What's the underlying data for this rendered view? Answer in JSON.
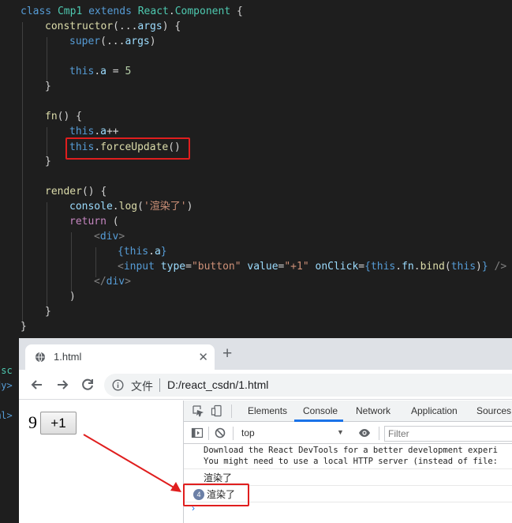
{
  "code": {
    "line1": [
      {
        "t": "class ",
        "c": "k"
      },
      {
        "t": "Cmp1 ",
        "c": "cls"
      },
      {
        "t": "extends ",
        "c": "k"
      },
      {
        "t": "React",
        "c": "cls"
      },
      {
        "t": ".",
        "c": ""
      },
      {
        "t": "Component",
        "c": "cls"
      },
      {
        "t": " {",
        "c": ""
      }
    ],
    "line2": [
      {
        "t": "constructor",
        "c": "fn"
      },
      {
        "t": "(...",
        "c": ""
      },
      {
        "t": "args",
        "c": "pr"
      },
      {
        "t": ") {",
        "c": ""
      }
    ],
    "line3": [
      {
        "t": "super",
        "c": "k"
      },
      {
        "t": "(...",
        "c": ""
      },
      {
        "t": "args",
        "c": "pr"
      },
      {
        "t": ")",
        "c": ""
      }
    ],
    "line5": [
      {
        "t": "this",
        "c": "k"
      },
      {
        "t": ".",
        "c": ""
      },
      {
        "t": "a",
        "c": "pr"
      },
      {
        "t": " = ",
        "c": ""
      },
      {
        "t": "5",
        "c": "num"
      }
    ],
    "line6": [
      {
        "t": "}",
        "c": ""
      }
    ],
    "line8": [
      {
        "t": "fn",
        "c": "fn"
      },
      {
        "t": "() {",
        "c": ""
      }
    ],
    "line9": [
      {
        "t": "this",
        "c": "k"
      },
      {
        "t": ".",
        "c": ""
      },
      {
        "t": "a",
        "c": "pr"
      },
      {
        "t": "++",
        "c": ""
      }
    ],
    "line10": [
      {
        "t": "this",
        "c": "k"
      },
      {
        "t": ".",
        "c": ""
      },
      {
        "t": "forceUpdate",
        "c": "fn"
      },
      {
        "t": "()",
        "c": ""
      }
    ],
    "line11": [
      {
        "t": "}",
        "c": ""
      }
    ],
    "line13": [
      {
        "t": "render",
        "c": "fn"
      },
      {
        "t": "() {",
        "c": ""
      }
    ],
    "line14": [
      {
        "t": "console",
        "c": "pr"
      },
      {
        "t": ".",
        "c": ""
      },
      {
        "t": "log",
        "c": "fn"
      },
      {
        "t": "(",
        "c": ""
      },
      {
        "t": "'渲染了'",
        "c": "str"
      },
      {
        "t": ")",
        "c": ""
      }
    ],
    "line15": [
      {
        "t": "return",
        "c": "kc"
      },
      {
        "t": " (",
        "c": ""
      }
    ],
    "line16": [
      {
        "t": "<",
        "c": "p"
      },
      {
        "t": "div",
        "c": "tag"
      },
      {
        "t": ">",
        "c": "p"
      }
    ],
    "line17": [
      {
        "t": "{",
        "c": "k"
      },
      {
        "t": "this",
        "c": "k"
      },
      {
        "t": ".",
        "c": ""
      },
      {
        "t": "a",
        "c": "pr"
      },
      {
        "t": "}",
        "c": "k"
      }
    ],
    "line18": [
      {
        "t": "<",
        "c": "p"
      },
      {
        "t": "input ",
        "c": "tag"
      },
      {
        "t": "type",
        "c": "pr"
      },
      {
        "t": "=",
        "c": ""
      },
      {
        "t": "\"button\"",
        "c": "str"
      },
      {
        "t": " ",
        "c": ""
      },
      {
        "t": "value",
        "c": "pr"
      },
      {
        "t": "=",
        "c": ""
      },
      {
        "t": "\"+1\"",
        "c": "str"
      },
      {
        "t": " ",
        "c": ""
      },
      {
        "t": "onClick",
        "c": "pr"
      },
      {
        "t": "=",
        "c": ""
      },
      {
        "t": "{",
        "c": "k"
      },
      {
        "t": "this",
        "c": "k"
      },
      {
        "t": ".",
        "c": ""
      },
      {
        "t": "fn",
        "c": "pr"
      },
      {
        "t": ".",
        "c": ""
      },
      {
        "t": "bind",
        "c": "fn"
      },
      {
        "t": "(",
        "c": ""
      },
      {
        "t": "this",
        "c": "k"
      },
      {
        "t": ")",
        "c": ""
      },
      {
        "t": "}",
        "c": "k"
      },
      {
        "t": " />",
        "c": "p"
      }
    ],
    "line19": [
      {
        "t": "</",
        "c": "p"
      },
      {
        "t": "div",
        "c": "tag"
      },
      {
        "t": ">",
        "c": "p"
      }
    ],
    "line20": [
      {
        "t": ")",
        "c": ""
      }
    ],
    "line21": [
      {
        "t": "}",
        "c": ""
      }
    ],
    "line22": [
      {
        "t": "}",
        "c": ""
      }
    ]
  },
  "side_strip": {
    "frag1": "/sc",
    "frag2": "dy>",
    "frag3": "ml>"
  },
  "browser": {
    "tab_title": "1.html",
    "tab_close": "✕",
    "new_tab": "+",
    "security_label": "文件",
    "url": "D:/react_csdn/1.html"
  },
  "page": {
    "count": "9",
    "button_value": "+1"
  },
  "devtools": {
    "tabs": [
      "Elements",
      "Console",
      "Network",
      "Application",
      "Sources"
    ],
    "context": "top",
    "filter_placeholder": "Filter",
    "message_line1": "Download the React DevTools for a better development experi",
    "message_line2": "You might need to use a local HTTP server (instead of file:",
    "log1": "渲染了",
    "log2": "渲染了",
    "repeat_count": "4",
    "prompt": "›"
  },
  "icons": [
    "globe-icon",
    "close-icon",
    "plus-icon",
    "back-arrow-icon",
    "forward-arrow-icon",
    "reload-icon",
    "info-icon",
    "inspect-element-icon",
    "device-toolbar-icon",
    "sidebar-toggle-icon",
    "clear-console-icon",
    "eye-icon",
    "dropdown-arrow-icon"
  ],
  "colors": {
    "editor_bg": "#1e1e1e",
    "highlight": "#e01e1e",
    "active_tab": "#1a73e8"
  }
}
